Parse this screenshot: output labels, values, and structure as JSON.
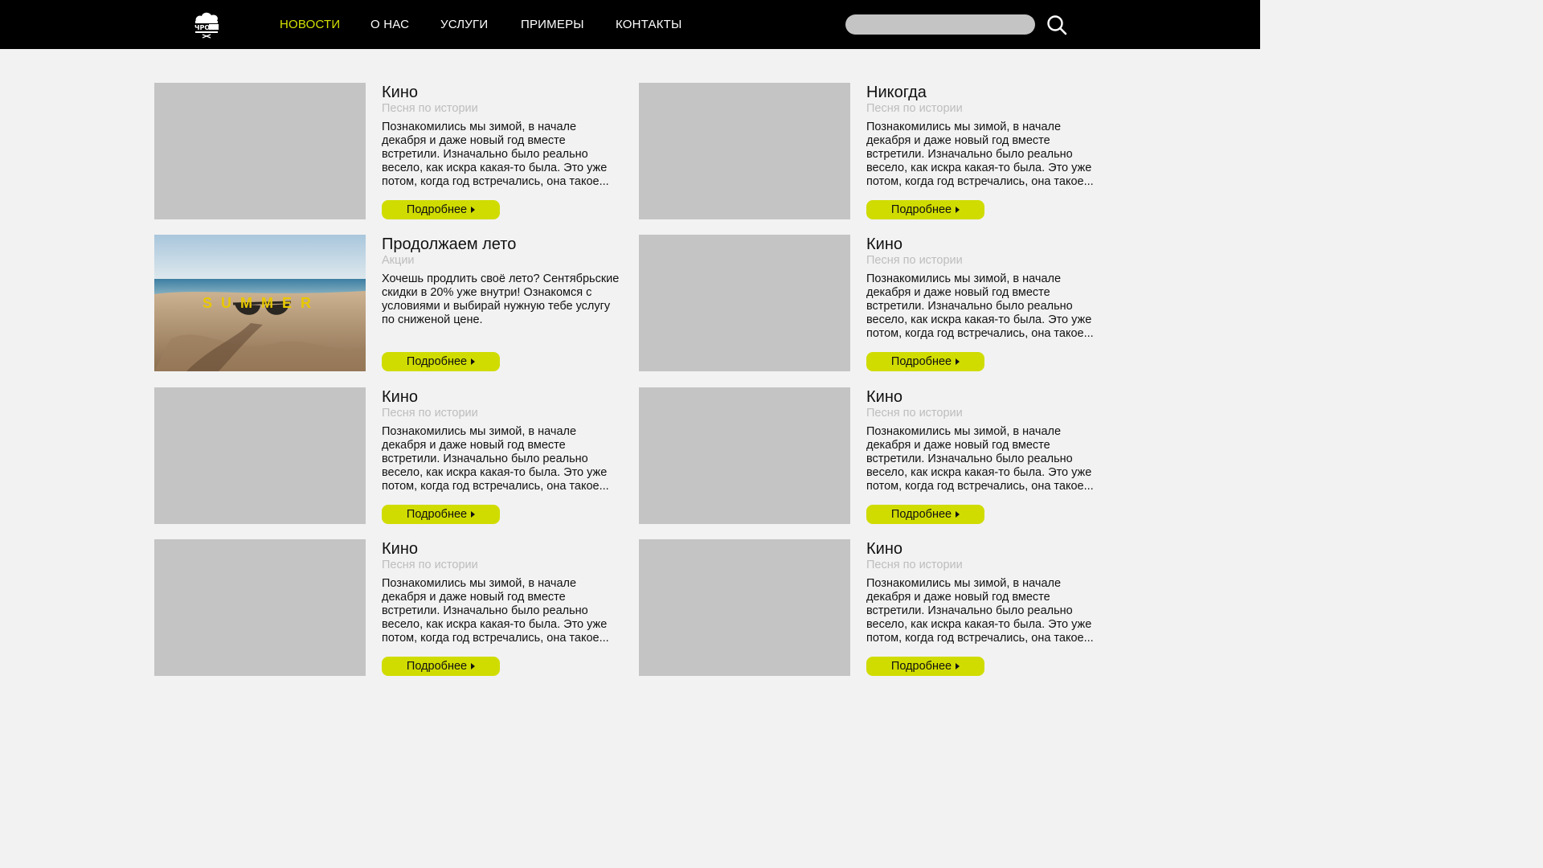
{
  "nav": {
    "items": [
      {
        "label": "НОВОСТИ",
        "active": true
      },
      {
        "label": "О НАС",
        "active": false
      },
      {
        "label": "УСЛУГИ",
        "active": false
      },
      {
        "label": "ПРИМЕРЫ",
        "active": false
      },
      {
        "label": "КОНТАКТЫ",
        "active": false
      }
    ]
  },
  "search": {
    "placeholder": "",
    "icon": "search-icon"
  },
  "logo": {
    "icon": "logo-icon"
  },
  "colors": {
    "accent": "#d4e000",
    "button": "#d0dc00",
    "header_bg": "#000000",
    "page_bg": "#f2f2f2",
    "placeholder": "#c4c4c4"
  },
  "cards": [
    {
      "title": "Кино",
      "subtitle": "Песня по истории",
      "text": "Познакомились мы зимой, в начале декабря и даже новый год вместе встретили. Изначально было реально весело, как искра какая-то была. Это уже потом, когда год встречались, она такое...",
      "button": "Подробнее",
      "image": "placeholder"
    },
    {
      "title": "Никогда",
      "subtitle": "Песня по истории",
      "text": "Познакомились мы зимой, в начале декабря и даже новый год вместе встретили. Изначально было реально весело, как искра какая-то была. Это уже потом, когда год встречались, она такое...",
      "button": "Подробнее",
      "image": "placeholder"
    },
    {
      "title": "Продолжаем лето",
      "subtitle": "Акции",
      "text": "Хочешь продлить своё лето? Сентябрьские скидки в 20% уже внутри! Ознакомся с условиями и выбирай нужную тебе услугу по сниженой цене.",
      "button": "Подробнее",
      "image": "summer-beach-photo",
      "image_caption": "SUMMER"
    },
    {
      "title": "Кино",
      "subtitle": "Песня по истории",
      "text": "Познакомились мы зимой, в начале декабря и даже новый год вместе встретили. Изначально было реально весело, как искра какая-то была. Это уже потом, когда год встречались, она такое...",
      "button": "Подробнее",
      "image": "placeholder"
    },
    {
      "title": "Кино",
      "subtitle": "Песня по истории",
      "text": "Познакомились мы зимой, в начале декабря и даже новый год вместе встретили. Изначально было реально весело, как искра какая-то была. Это уже потом, когда год встречались, она такое...",
      "button": "Подробнее",
      "image": "placeholder"
    },
    {
      "title": "Кино",
      "subtitle": "Песня по истории",
      "text": "Познакомились мы зимой, в начале декабря и даже новый год вместе встретили. Изначально было реально весело, как искра какая-то была. Это уже потом, когда год встречались, она такое...",
      "button": "Подробнее",
      "image": "placeholder"
    },
    {
      "title": "Кино",
      "subtitle": "Песня по истории",
      "text": "Познакомились мы зимой, в начале декабря и даже новый год вместе встретили. Изначально было реально весело, как искра какая-то была. Это уже потом, когда год встречались, она такое...",
      "button": "Подробнее",
      "image": "placeholder"
    },
    {
      "title": "Кино",
      "subtitle": "Песня по истории",
      "text": "Познакомились мы зимой, в начале декабря и даже новый год вместе встретили. Изначально было реально весело, как искра какая-то была. Это уже потом, когда год встречались, она такое...",
      "button": "Подробнее",
      "image": "placeholder"
    }
  ]
}
